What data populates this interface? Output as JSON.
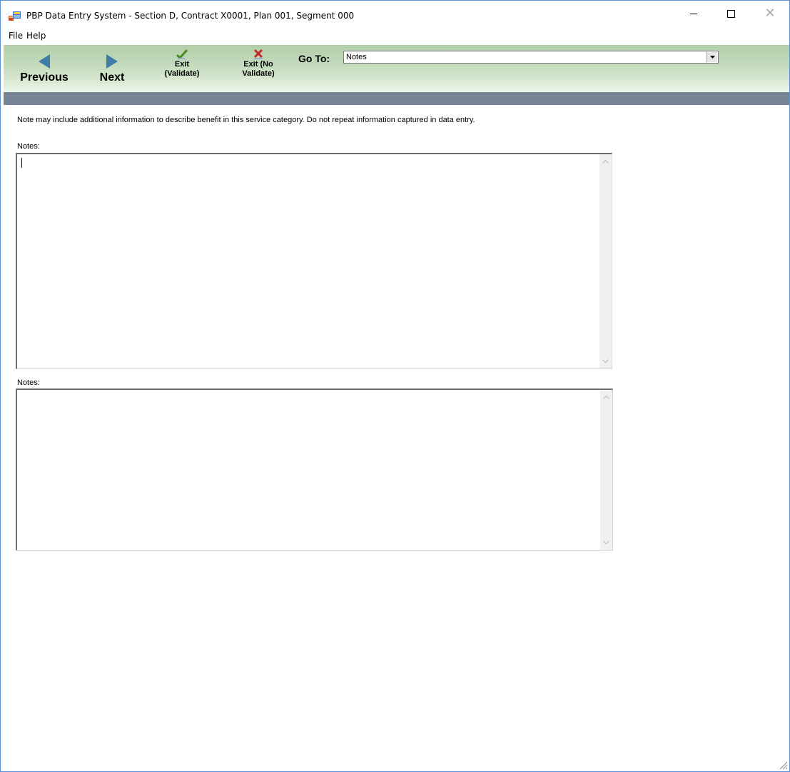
{
  "window": {
    "title": "PBP Data Entry System - Section D, Contract X0001, Plan 001, Segment 000",
    "icon": "pbp-app-icon",
    "controls": [
      "minimize-icon",
      "maximize-icon",
      "close-icon"
    ]
  },
  "menu": {
    "items": [
      {
        "label": "File"
      },
      {
        "label": "Help"
      }
    ]
  },
  "toolbar": {
    "previous_label": "Previous",
    "next_label": "Next",
    "exit_validate_label_line1": "Exit",
    "exit_validate_label_line2": "(Validate)",
    "exit_no_validate_label_line1": "Exit (No",
    "exit_no_validate_label_line2": "Validate)",
    "goto_label": "Go To:",
    "goto_value": "Notes",
    "colors": {
      "arrow": "#3f7da6",
      "check": "#4a8a1f",
      "x_mark": "#c62828",
      "band": "#768595"
    }
  },
  "content": {
    "instruction": "Note may include additional information to describe benefit in this service category. Do not repeat information captured in data entry.",
    "fields": [
      {
        "label": "Notes:",
        "value": ""
      },
      {
        "label": "Notes:",
        "value": ""
      }
    ]
  }
}
